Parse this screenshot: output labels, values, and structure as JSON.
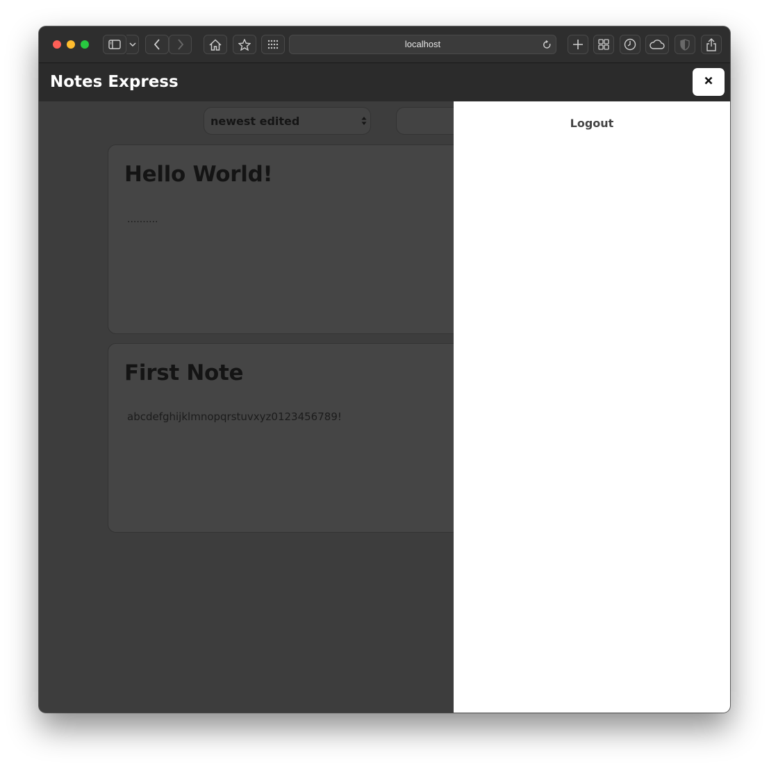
{
  "browser": {
    "url": "localhost",
    "icons": [
      "sidebar-icon",
      "chevron-down-icon",
      "back-icon",
      "forward-icon",
      "home-icon",
      "star-icon",
      "grid-icon",
      "reload-icon",
      "plus-icon",
      "tabs-overview-icon",
      "history-icon",
      "cloud-icon",
      "shield-icon",
      "share-icon"
    ]
  },
  "app": {
    "title": "Notes Express",
    "close_label": "×"
  },
  "controls": {
    "sort_value": "newest edited"
  },
  "notes": [
    {
      "title": "Hello World!",
      "body": ".........."
    },
    {
      "title": "First Note",
      "body": "abcdefghijklmnopqrstuvxyz0123456789!"
    }
  ],
  "drawer": {
    "logout_label": "Logout"
  },
  "colors": {
    "overlay": "#3d3d3d",
    "drawer": "#ffffff",
    "header": "#2b2b2b",
    "traffic_red": "#fe5f57",
    "traffic_yellow": "#febc2e",
    "traffic_green": "#28c840"
  }
}
